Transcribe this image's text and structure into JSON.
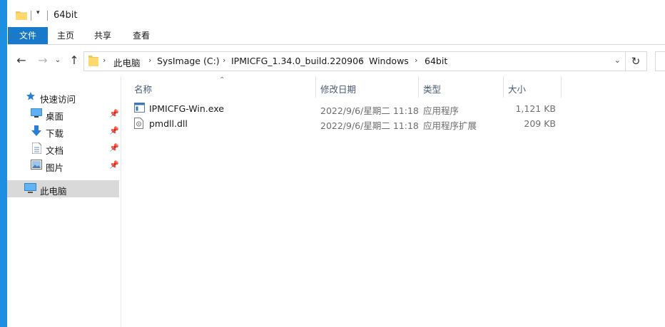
{
  "window": {
    "title": "64bit",
    "accent_color": "#1979ca"
  },
  "ribbon": {
    "tabs": [
      {
        "label": "文件"
      },
      {
        "label": "主页"
      },
      {
        "label": "共享"
      },
      {
        "label": "查看"
      }
    ]
  },
  "address_bar": {
    "crumbs": [
      "此电脑",
      "SysImage (C:)",
      "IPMICFG_1.34.0_build.220906",
      "Windows",
      "64bit"
    ]
  },
  "nav_pane": {
    "quick_access_label": "快速访问",
    "items": [
      {
        "label": "桌面",
        "icon": "desktop-icon",
        "pinned": true
      },
      {
        "label": "下载",
        "icon": "download-icon",
        "pinned": true
      },
      {
        "label": "文档",
        "icon": "documents-icon",
        "pinned": true
      },
      {
        "label": "图片",
        "icon": "pictures-icon",
        "pinned": true
      }
    ],
    "this_pc_label": "此电脑"
  },
  "file_list": {
    "columns": [
      "名称",
      "修改日期",
      "类型",
      "大小"
    ],
    "rows": [
      {
        "name": "IPMICFG-Win.exe",
        "date": "2022/9/6/星期二 11:18",
        "type": "应用程序",
        "size": "1,121 KB",
        "icon": "exe-file-icon"
      },
      {
        "name": "pmdll.dll",
        "date": "2022/9/6/星期二 11:18",
        "type": "应用程序扩展",
        "size": "209 KB",
        "icon": "dll-file-icon"
      }
    ]
  }
}
